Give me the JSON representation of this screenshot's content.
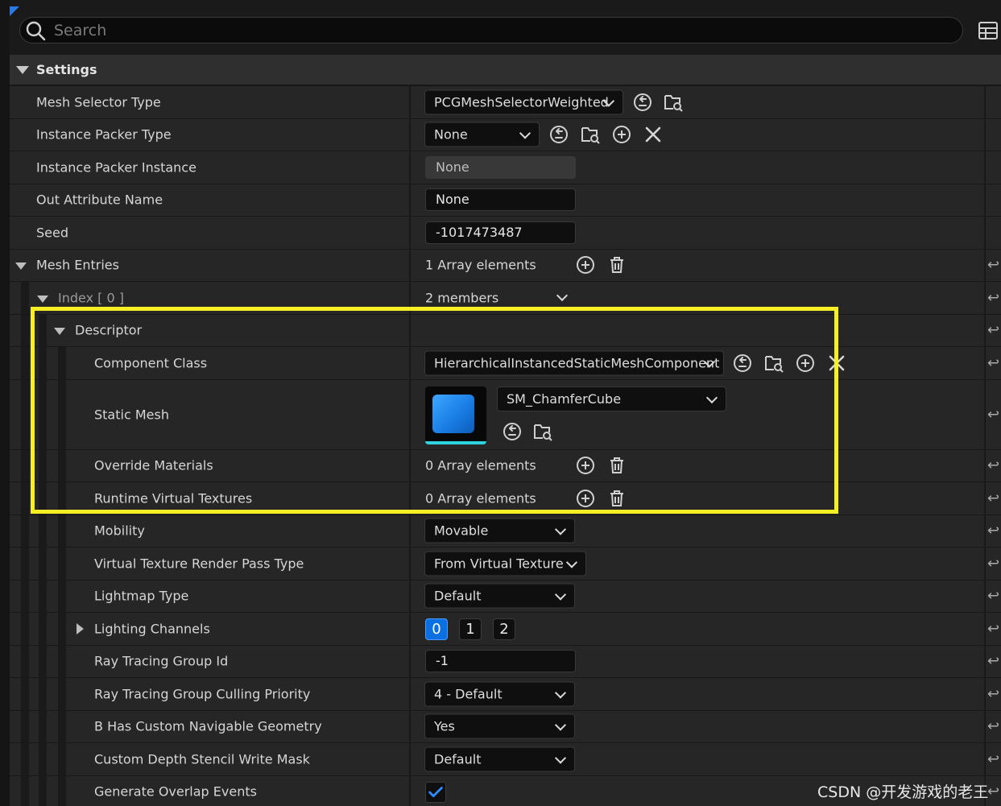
{
  "search": {
    "placeholder": "Search"
  },
  "section": {
    "title": "Settings"
  },
  "rows": {
    "mesh_selector_type": {
      "label": "Mesh Selector Type",
      "value": "PCGMeshSelectorWeighted"
    },
    "instance_packer_type": {
      "label": "Instance Packer Type",
      "value": "None"
    },
    "instance_packer_instance": {
      "label": "Instance Packer Instance",
      "value": "None"
    },
    "out_attribute_name": {
      "label": "Out Attribute Name",
      "value": "None"
    },
    "seed": {
      "label": "Seed",
      "value": "-1017473487"
    },
    "mesh_entries": {
      "label": "Mesh Entries",
      "value": "1 Array elements"
    },
    "index0": {
      "label": "Index [ 0 ]",
      "value": "2 members"
    },
    "descriptor": {
      "label": "Descriptor"
    },
    "component_class": {
      "label": "Component Class",
      "value": "HierarchicalInstancedStaticMeshComponent"
    },
    "static_mesh": {
      "label": "Static Mesh",
      "value": "SM_ChamferCube"
    },
    "override_materials": {
      "label": "Override Materials",
      "value": "0 Array elements"
    },
    "runtime_virtual_textures": {
      "label": "Runtime Virtual Textures",
      "value": "0 Array elements"
    },
    "mobility": {
      "label": "Mobility",
      "value": "Movable"
    },
    "vt_render_pass": {
      "label": "Virtual Texture Render Pass Type",
      "value": "From Virtual Texture"
    },
    "lightmap_type": {
      "label": "Lightmap Type",
      "value": "Default"
    },
    "lighting_channels": {
      "label": "Lighting Channels",
      "channels": [
        "0",
        "1",
        "2"
      ],
      "selected": "0"
    },
    "ray_tracing_group_id": {
      "label": "Ray Tracing Group Id",
      "value": "-1"
    },
    "ray_tracing_culling_priority": {
      "label": "Ray Tracing Group Culling Priority",
      "value": "4 - Default"
    },
    "navigable_geometry": {
      "label": "B Has Custom Navigable Geometry",
      "value": "Yes"
    },
    "custom_depth_stencil": {
      "label": "Custom Depth Stencil Write Mask",
      "value": "Default"
    },
    "generate_overlap_events": {
      "label": "Generate Overlap Events",
      "checked": true
    }
  },
  "watermark": "CSDN @开发游戏的老王",
  "colors": {
    "highlight": "#f5ef24",
    "accent": "#0a6fe0",
    "check": "#2f8cff"
  },
  "icons": [
    "search-icon",
    "table-view-icon",
    "use-selected-icon",
    "browse-icon",
    "add-icon",
    "clear-icon",
    "delete-icon",
    "reset-arrow-icon",
    "checkmark-icon"
  ]
}
